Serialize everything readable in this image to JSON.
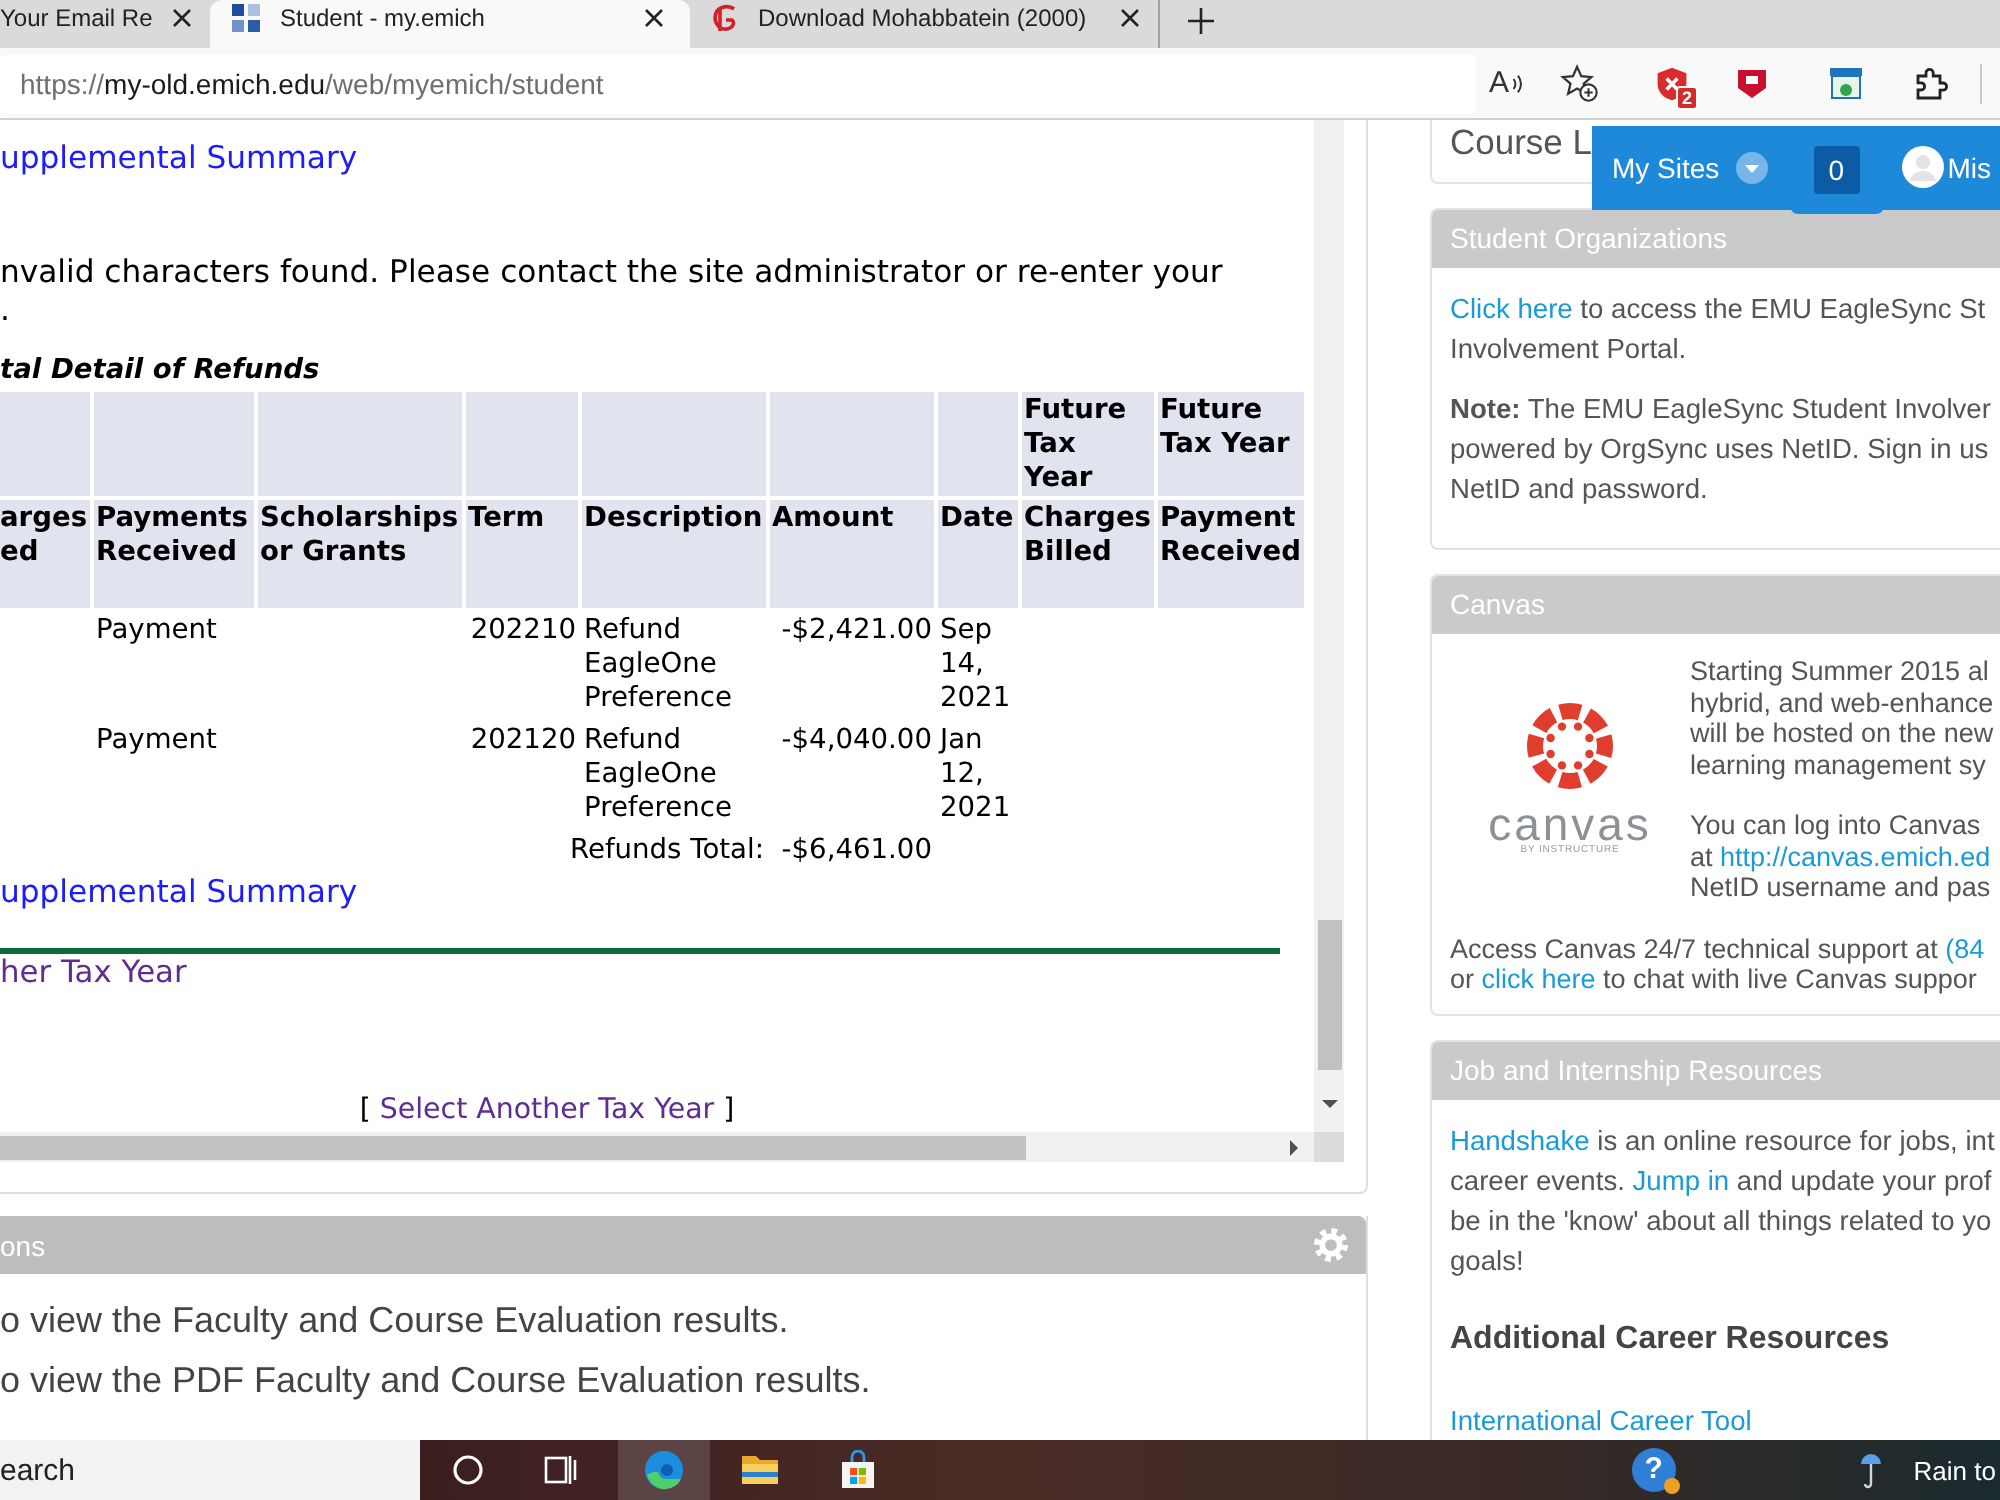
{
  "browser": {
    "tabs": [
      {
        "kind": "plain",
        "title": "Your Email Re",
        "selected": false
      },
      {
        "kind": "grid",
        "title": "Student - my.emich",
        "selected": true
      },
      {
        "kind": "brand",
        "title": "Download Mohabbatein (2000)",
        "selected": false
      }
    ],
    "address": {
      "scheme": "https://",
      "host": "my-old.emich.edu",
      "path": "/web/myemich/student"
    },
    "read_aloud_glyph": "A",
    "extensions": [
      {
        "kind": "shield",
        "badge": "2"
      },
      {
        "kind": "crest"
      },
      {
        "kind": "window"
      },
      {
        "kind": "puzzle"
      }
    ]
  },
  "statement": {
    "top_link": {
      "text": "upplemental Summary",
      "visited": false
    },
    "message": [
      "nvalid characters found. Please contact the site administrator or re-enter your",
      "."
    ],
    "table_title": "tal Detail of Refunds",
    "columns": [
      {
        "label": "arges ed"
      },
      {
        "label": "Payments Received"
      },
      {
        "label": "Scholarships or Grants"
      },
      {
        "label": "Term"
      },
      {
        "label": "Description"
      },
      {
        "label": "Amount"
      },
      {
        "label": "Date"
      },
      {
        "group": "Future Tax Year",
        "label": "Charges Billed"
      },
      {
        "group": "Future Tax Year",
        "label": "Payment Received"
      }
    ],
    "rows": [
      {
        "payments_received": "Payment",
        "term": "202210",
        "description": "Refund EagleOne Preference",
        "amount": "-$2,421.00",
        "date": "Sep 14, 2021"
      },
      {
        "payments_received": "Payment",
        "term": "202120",
        "description": "Refund EagleOne Preference",
        "amount": "-$4,040.00",
        "date": "Jan 12, 2021"
      }
    ],
    "total": {
      "label": "Refunds Total:",
      "amount": "-$6,461.00"
    },
    "bottom_link": {
      "text": "upplemental Summary",
      "visited": false
    },
    "other_year_link": {
      "text": "her Tax Year",
      "visited": true
    },
    "select_year": {
      "prefix": "[",
      "link": {
        "text": "Select Another Tax Year",
        "visited": true
      },
      "suffix": "]"
    }
  },
  "evaluations": {
    "title": "ons",
    "lines": [
      "o view the Faculty and Course Evaluation results.",
      "o view the PDF Faculty and Course Evaluation results."
    ]
  },
  "my_sites": {
    "label": "My Sites",
    "count": "0",
    "user": "Mis"
  },
  "side": {
    "course_card": "Course L",
    "cards": [
      {
        "kind": "text",
        "title": "Student Organizations",
        "paragraphs": [
          [
            [
              {
                "kind": "link",
                "text": "Click here"
              },
              {
                "kind": "text",
                "text": " to access the EMU EagleSync St"
              }
            ],
            [
              {
                "kind": "text",
                "text": "Involvement Portal."
              }
            ]
          ],
          [
            [
              {
                "kind": "text",
                "text": "**Note:** The EMU EagleSync Student Involver"
              }
            ],
            [
              {
                "kind": "text",
                "text": "powered by OrgSync uses NetID. Sign in us"
              }
            ],
            [
              {
                "kind": "text",
                "text": "NetID and password."
              }
            ]
          ]
        ]
      },
      {
        "kind": "canvas",
        "title": "Canvas",
        "logo": {
          "wordmark": "canvas",
          "tagline": "BY INSTRUCTURE"
        },
        "intro": [
          [
            [
              {
                "kind": "text",
                "text": "Starting Summer 2015 al"
              }
            ],
            [
              {
                "kind": "text",
                "text": "hybrid, and web-enhance"
              }
            ],
            [
              {
                "kind": "text",
                "text": "will be hosted on the new"
              }
            ],
            [
              {
                "kind": "text",
                "text": "learning management sy"
              }
            ]
          ],
          [
            [
              {
                "kind": "text",
                "text": "You can log into Canvas"
              }
            ],
            [
              {
                "kind": "text",
                "text": "at "
              },
              {
                "kind": "link",
                "text": "http://canvas.emich.ed"
              }
            ],
            [
              {
                "kind": "text",
                "text": "NetID username and pas"
              }
            ]
          ]
        ],
        "paragraphs": [
          [
            [
              {
                "kind": "text",
                "text": "Access Canvas 24/7 technical support at "
              },
              {
                "kind": "link",
                "text": "(84"
              }
            ],
            [
              {
                "kind": "text",
                "text": "or "
              },
              {
                "kind": "link",
                "text": "click here"
              },
              {
                "kind": "text",
                "text": " to chat with live Canvas suppor"
              }
            ]
          ]
        ]
      },
      {
        "kind": "text",
        "title": "Job and Internship Resources",
        "paragraphs": [
          [
            [
              {
                "kind": "link",
                "text": "Handshake"
              },
              {
                "kind": "text",
                "text": " is an online resource for jobs, int"
              }
            ],
            [
              {
                "kind": "text",
                "text": "career events. "
              },
              {
                "kind": "link",
                "text": "Jump in"
              },
              {
                "kind": "text",
                "text": " and update your prof"
              }
            ],
            [
              {
                "kind": "text",
                "text": "be in the 'know' about all things related to yo"
              }
            ],
            [
              {
                "kind": "text",
                "text": "goals!"
              }
            ]
          ]
        ],
        "subheading": "Additional Career Resources",
        "links": [
          "International Career Tool"
        ]
      }
    ]
  },
  "taskbar": {
    "search": {
      "placeholder": "earch"
    },
    "apps": [
      {
        "kind": "cortana",
        "selected": false
      },
      {
        "kind": "task_view",
        "selected": false
      },
      {
        "kind": "edge",
        "selected": true
      },
      {
        "kind": "explorer",
        "selected": false
      },
      {
        "kind": "store",
        "selected": false
      }
    ],
    "help_glyph": "?",
    "weather": "Rain to"
  }
}
